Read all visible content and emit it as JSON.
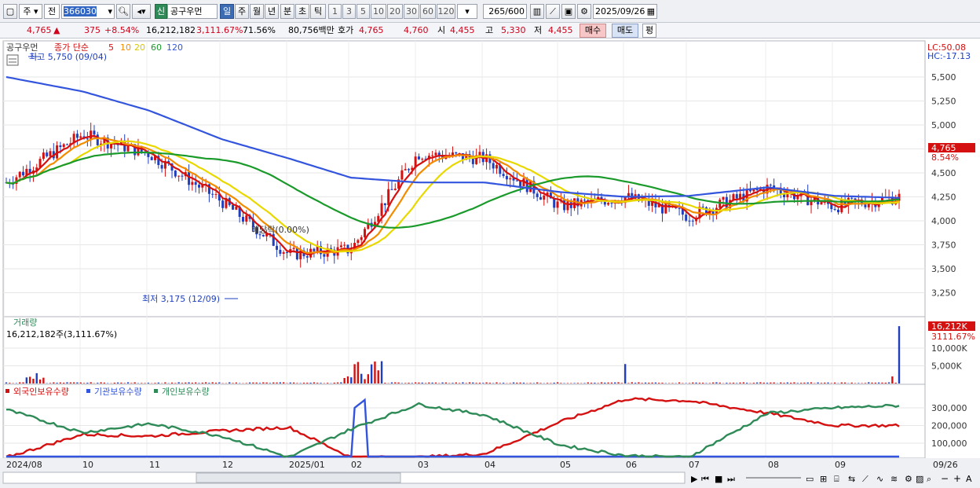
{
  "toolbar": {
    "period_type": "주",
    "prev_label": "전",
    "stock_code": "366030",
    "badge": "신",
    "stock_name": "공구우먼",
    "timeframes": [
      "일",
      "주",
      "월",
      "년",
      "분",
      "초",
      "틱"
    ],
    "active_timeframe": "일",
    "intervals": [
      "1",
      "3",
      "5",
      "10",
      "20",
      "30",
      "60",
      "120"
    ],
    "count": "265",
    "count_total": "/600",
    "date": "2025/09/26"
  },
  "quote": {
    "price": "4,765",
    "arrow": "▲",
    "change": "375",
    "change_pct": "+8.54%",
    "volume": "16,212,182",
    "volume_ratio": "3,111.67%",
    "turnover_pct": "71.56%",
    "amount": "80,756백만",
    "bid_label": "호가",
    "ask_price": "4,765",
    "bid_price": "4,760",
    "open_label": "시",
    "open": "4,455",
    "high_label": "고",
    "high": "5,330",
    "low_label": "저",
    "low": "4,455",
    "buy_label": "매수",
    "sell_label": "매도",
    "avg_label": "평"
  },
  "price_panel": {
    "title": "공구우먼",
    "ma_label": "종가 단순",
    "ma_periods": [
      "5",
      "10",
      "20",
      "60",
      "120"
    ],
    "ma_colors": [
      "#d41010",
      "#f28c00",
      "#e8d800",
      "#1a9a2a",
      "#3355dd"
    ],
    "high_note": "최고 5,750 (09/04)",
    "low_note": "최저 3,175 (12/09)",
    "disparity_note": "배당락(0.00%)",
    "lc": "LC:50.08",
    "hc": "HC:-17.13",
    "y_ticks": [
      "5,500",
      "5,250",
      "5,000",
      "4,750",
      "4,500",
      "4,250",
      "4,000",
      "3,750",
      "3,500",
      "3,250"
    ],
    "last_price_tag": "4,765",
    "last_pct_tag": "8.54%"
  },
  "volume_panel": {
    "title": "거래량",
    "value_text": "16,212,182주(3,111.67%)",
    "y_ticks": [
      "10,000K",
      "5,000K"
    ],
    "last_tag": "16,212K",
    "last_pct": "3111.67%"
  },
  "holdings_panel": {
    "series": [
      "외국인보유수량",
      "기관보유수량",
      "개인보유수량"
    ],
    "colors": [
      "#d41010",
      "#3355dd",
      "#2e8b57"
    ],
    "y_ticks": [
      "300,000",
      "200,000",
      "100,000"
    ]
  },
  "x_axis": {
    "labels": [
      "2024/08",
      "10",
      "11",
      "12",
      "2025/01",
      "02",
      "03",
      "04",
      "05",
      "06",
      "07",
      "08",
      "09",
      "09/26"
    ]
  },
  "chart_data": {
    "type": "line",
    "x": [
      "2024/08",
      "2024/09",
      "2024/10",
      "2024/11",
      "2024/12",
      "2025/01",
      "2025/02",
      "2025/03",
      "2025/04",
      "2025/05",
      "2025/06",
      "2025/07",
      "2025/08",
      "2025/09",
      "2025/09/26"
    ],
    "series": [
      {
        "name": "5",
        "values": [
          4400,
          4900,
          4700,
          4200,
          3650,
          3700,
          4700,
          4650,
          4150,
          4250,
          4050,
          4350,
          4150,
          4300,
          4765
        ]
      },
      {
        "name": "120",
        "values": [
          5500,
          5350,
          5150,
          4850,
          4650,
          4450,
          4400,
          4400,
          4300,
          4250,
          4260,
          4350,
          4260,
          4230,
          4250
        ]
      }
    ],
    "ylim": [
      3150,
      5700
    ]
  }
}
